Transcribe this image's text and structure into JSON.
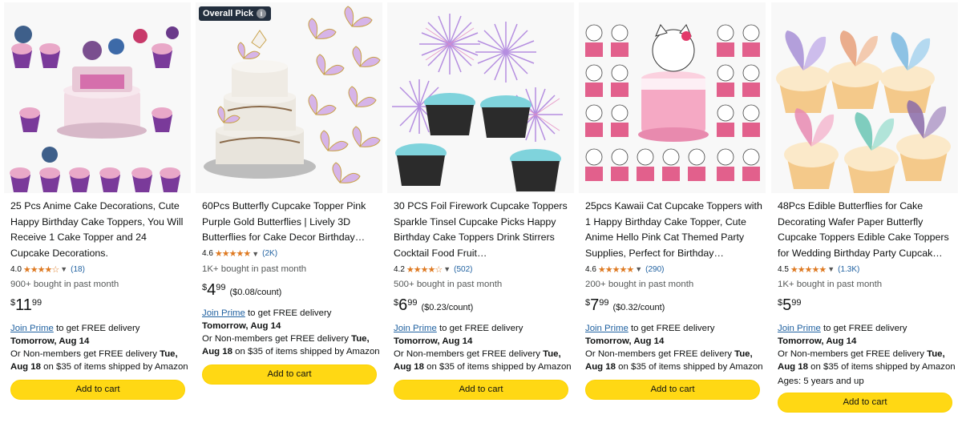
{
  "products": [
    {
      "title": "25 Pcs Anime Cake Decorations, Cute Happy Birthday Cake Toppers, You Will Receive 1 Cake Topper and 24 Cupcake Decorations.",
      "rating": "4.0",
      "stars": "★★★★☆",
      "reviews": "(18)",
      "bought": "900+ bought in past month",
      "price_symbol": "$",
      "price_whole": "11",
      "price_fraction": "99",
      "unit_price": "",
      "join_prime": "Join Prime",
      "prime_text": " to get FREE delivery ",
      "prime_date": "Tomorrow, Aug 14",
      "nonmember_text": "Or Non-members get FREE delivery ",
      "nonmember_date": "Tue, Aug 18",
      "nonmember_tail": " on $35 of items shipped by Amazon",
      "ages": "",
      "add_to_cart": "Add to cart"
    },
    {
      "badge": "Overall Pick",
      "title": "60Pcs Butterfly Cupcake Topper Pink Purple Gold Butterflies | Lively 3D Butterflies for Cake Decor Birthday…",
      "rating": "4.6",
      "stars": "★★★★★",
      "reviews": "(2K)",
      "bought": "1K+ bought in past month",
      "price_symbol": "$",
      "price_whole": "4",
      "price_fraction": "99",
      "unit_price": "($0.08/count)",
      "join_prime": "Join Prime",
      "prime_text": " to get FREE delivery ",
      "prime_date": "Tomorrow, Aug 14",
      "nonmember_text": "Or Non-members get FREE delivery ",
      "nonmember_date": "Tue, Aug 18",
      "nonmember_tail": " on $35 of items shipped by Amazon",
      "ages": "",
      "add_to_cart": "Add to cart"
    },
    {
      "title": "30 PCS Foil Firework Cupcake Toppers Sparkle Tinsel Cupcake Picks Happy Birthday Cake Toppers Drink Stirrers Cocktail Food Fruit…",
      "rating": "4.2",
      "stars": "★★★★☆",
      "reviews": "(502)",
      "bought": "500+ bought in past month",
      "price_symbol": "$",
      "price_whole": "6",
      "price_fraction": "99",
      "unit_price": "($0.23/count)",
      "join_prime": "Join Prime",
      "prime_text": " to get FREE delivery ",
      "prime_date": "Tomorrow, Aug 14",
      "nonmember_text": "Or Non-members get FREE delivery ",
      "nonmember_date": "Tue, Aug 18",
      "nonmember_tail": " on $35 of items shipped by Amazon",
      "ages": "",
      "add_to_cart": "Add to cart"
    },
    {
      "title": "25pcs Kawaii Cat Cupcake Toppers with 1 Happy Birthday Cake Topper, Cute Anime Hello Pink Cat Themed Party Supplies, Perfect for Birthday…",
      "rating": "4.6",
      "stars": "★★★★★",
      "reviews": "(290)",
      "bought": "200+ bought in past month",
      "price_symbol": "$",
      "price_whole": "7",
      "price_fraction": "99",
      "unit_price": "($0.32/count)",
      "join_prime": "Join Prime",
      "prime_text": " to get FREE delivery ",
      "prime_date": "Tomorrow, Aug 14",
      "nonmember_text": "Or Non-members get FREE delivery ",
      "nonmember_date": "Tue, Aug 18",
      "nonmember_tail": " on $35 of items shipped by Amazon",
      "ages": "",
      "add_to_cart": "Add to cart"
    },
    {
      "title": "48Pcs Edible Butterflies for Cake Decorating Wafer Paper Butterfly Cupcake Toppers Edible Cake Toppers for Wedding Birthday Party Cupcak…",
      "rating": "4.5",
      "stars": "★★★★★",
      "reviews": "(1.3K)",
      "bought": "1K+ bought in past month",
      "price_symbol": "$",
      "price_whole": "5",
      "price_fraction": "99",
      "unit_price": "",
      "join_prime": "Join Prime",
      "prime_text": " to get FREE delivery ",
      "prime_date": "Tomorrow, Aug 14",
      "nonmember_text": "Or Non-members get FREE delivery ",
      "nonmember_date": "Tue, Aug 18",
      "nonmember_tail": " on $35 of items shipped by Amazon",
      "ages": "Ages: 5 years and up",
      "add_to_cart": "Add to cart"
    }
  ],
  "colors": {
    "star": "#de7921",
    "link": "#2162a1",
    "cart_button": "#ffd814",
    "badge_bg": "#232f3e"
  }
}
